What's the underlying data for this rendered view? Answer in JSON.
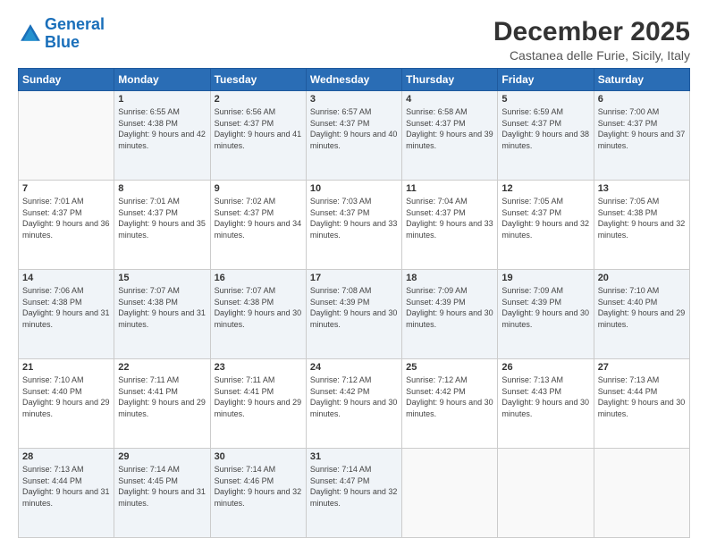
{
  "logo": {
    "line1": "General",
    "line2": "Blue"
  },
  "header": {
    "month": "December 2025",
    "location": "Castanea delle Furie, Sicily, Italy"
  },
  "days_of_week": [
    "Sunday",
    "Monday",
    "Tuesday",
    "Wednesday",
    "Thursday",
    "Friday",
    "Saturday"
  ],
  "weeks": [
    [
      {
        "day": "",
        "sunrise": "",
        "sunset": "",
        "daylight": ""
      },
      {
        "day": "1",
        "sunrise": "Sunrise: 6:55 AM",
        "sunset": "Sunset: 4:38 PM",
        "daylight": "Daylight: 9 hours and 42 minutes."
      },
      {
        "day": "2",
        "sunrise": "Sunrise: 6:56 AM",
        "sunset": "Sunset: 4:37 PM",
        "daylight": "Daylight: 9 hours and 41 minutes."
      },
      {
        "day": "3",
        "sunrise": "Sunrise: 6:57 AM",
        "sunset": "Sunset: 4:37 PM",
        "daylight": "Daylight: 9 hours and 40 minutes."
      },
      {
        "day": "4",
        "sunrise": "Sunrise: 6:58 AM",
        "sunset": "Sunset: 4:37 PM",
        "daylight": "Daylight: 9 hours and 39 minutes."
      },
      {
        "day": "5",
        "sunrise": "Sunrise: 6:59 AM",
        "sunset": "Sunset: 4:37 PM",
        "daylight": "Daylight: 9 hours and 38 minutes."
      },
      {
        "day": "6",
        "sunrise": "Sunrise: 7:00 AM",
        "sunset": "Sunset: 4:37 PM",
        "daylight": "Daylight: 9 hours and 37 minutes."
      }
    ],
    [
      {
        "day": "7",
        "sunrise": "Sunrise: 7:01 AM",
        "sunset": "Sunset: 4:37 PM",
        "daylight": "Daylight: 9 hours and 36 minutes."
      },
      {
        "day": "8",
        "sunrise": "Sunrise: 7:01 AM",
        "sunset": "Sunset: 4:37 PM",
        "daylight": "Daylight: 9 hours and 35 minutes."
      },
      {
        "day": "9",
        "sunrise": "Sunrise: 7:02 AM",
        "sunset": "Sunset: 4:37 PM",
        "daylight": "Daylight: 9 hours and 34 minutes."
      },
      {
        "day": "10",
        "sunrise": "Sunrise: 7:03 AM",
        "sunset": "Sunset: 4:37 PM",
        "daylight": "Daylight: 9 hours and 33 minutes."
      },
      {
        "day": "11",
        "sunrise": "Sunrise: 7:04 AM",
        "sunset": "Sunset: 4:37 PM",
        "daylight": "Daylight: 9 hours and 33 minutes."
      },
      {
        "day": "12",
        "sunrise": "Sunrise: 7:05 AM",
        "sunset": "Sunset: 4:37 PM",
        "daylight": "Daylight: 9 hours and 32 minutes."
      },
      {
        "day": "13",
        "sunrise": "Sunrise: 7:05 AM",
        "sunset": "Sunset: 4:38 PM",
        "daylight": "Daylight: 9 hours and 32 minutes."
      }
    ],
    [
      {
        "day": "14",
        "sunrise": "Sunrise: 7:06 AM",
        "sunset": "Sunset: 4:38 PM",
        "daylight": "Daylight: 9 hours and 31 minutes."
      },
      {
        "day": "15",
        "sunrise": "Sunrise: 7:07 AM",
        "sunset": "Sunset: 4:38 PM",
        "daylight": "Daylight: 9 hours and 31 minutes."
      },
      {
        "day": "16",
        "sunrise": "Sunrise: 7:07 AM",
        "sunset": "Sunset: 4:38 PM",
        "daylight": "Daylight: 9 hours and 30 minutes."
      },
      {
        "day": "17",
        "sunrise": "Sunrise: 7:08 AM",
        "sunset": "Sunset: 4:39 PM",
        "daylight": "Daylight: 9 hours and 30 minutes."
      },
      {
        "day": "18",
        "sunrise": "Sunrise: 7:09 AM",
        "sunset": "Sunset: 4:39 PM",
        "daylight": "Daylight: 9 hours and 30 minutes."
      },
      {
        "day": "19",
        "sunrise": "Sunrise: 7:09 AM",
        "sunset": "Sunset: 4:39 PM",
        "daylight": "Daylight: 9 hours and 30 minutes."
      },
      {
        "day": "20",
        "sunrise": "Sunrise: 7:10 AM",
        "sunset": "Sunset: 4:40 PM",
        "daylight": "Daylight: 9 hours and 29 minutes."
      }
    ],
    [
      {
        "day": "21",
        "sunrise": "Sunrise: 7:10 AM",
        "sunset": "Sunset: 4:40 PM",
        "daylight": "Daylight: 9 hours and 29 minutes."
      },
      {
        "day": "22",
        "sunrise": "Sunrise: 7:11 AM",
        "sunset": "Sunset: 4:41 PM",
        "daylight": "Daylight: 9 hours and 29 minutes."
      },
      {
        "day": "23",
        "sunrise": "Sunrise: 7:11 AM",
        "sunset": "Sunset: 4:41 PM",
        "daylight": "Daylight: 9 hours and 29 minutes."
      },
      {
        "day": "24",
        "sunrise": "Sunrise: 7:12 AM",
        "sunset": "Sunset: 4:42 PM",
        "daylight": "Daylight: 9 hours and 30 minutes."
      },
      {
        "day": "25",
        "sunrise": "Sunrise: 7:12 AM",
        "sunset": "Sunset: 4:42 PM",
        "daylight": "Daylight: 9 hours and 30 minutes."
      },
      {
        "day": "26",
        "sunrise": "Sunrise: 7:13 AM",
        "sunset": "Sunset: 4:43 PM",
        "daylight": "Daylight: 9 hours and 30 minutes."
      },
      {
        "day": "27",
        "sunrise": "Sunrise: 7:13 AM",
        "sunset": "Sunset: 4:44 PM",
        "daylight": "Daylight: 9 hours and 30 minutes."
      }
    ],
    [
      {
        "day": "28",
        "sunrise": "Sunrise: 7:13 AM",
        "sunset": "Sunset: 4:44 PM",
        "daylight": "Daylight: 9 hours and 31 minutes."
      },
      {
        "day": "29",
        "sunrise": "Sunrise: 7:14 AM",
        "sunset": "Sunset: 4:45 PM",
        "daylight": "Daylight: 9 hours and 31 minutes."
      },
      {
        "day": "30",
        "sunrise": "Sunrise: 7:14 AM",
        "sunset": "Sunset: 4:46 PM",
        "daylight": "Daylight: 9 hours and 32 minutes."
      },
      {
        "day": "31",
        "sunrise": "Sunrise: 7:14 AM",
        "sunset": "Sunset: 4:47 PM",
        "daylight": "Daylight: 9 hours and 32 minutes."
      },
      {
        "day": "",
        "sunrise": "",
        "sunset": "",
        "daylight": ""
      },
      {
        "day": "",
        "sunrise": "",
        "sunset": "",
        "daylight": ""
      },
      {
        "day": "",
        "sunrise": "",
        "sunset": "",
        "daylight": ""
      }
    ]
  ]
}
